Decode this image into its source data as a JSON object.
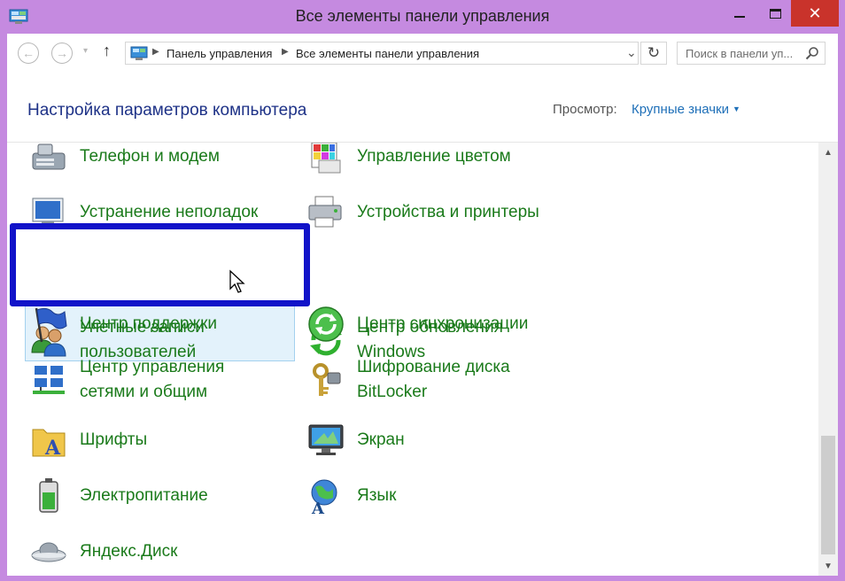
{
  "window": {
    "title": "Все элементы панели управления",
    "close_glyph": "✕"
  },
  "navbar": {
    "back_glyph": "←",
    "forward_glyph": "→",
    "history_glyph": "▾",
    "up_glyph": "↑",
    "breadcrumbs": [
      "Панель управления",
      "Все элементы панели управления"
    ],
    "crumb_separator": "▶",
    "dropdown_glyph": "⌄",
    "refresh_glyph": "↻",
    "search_placeholder": "Поиск в панели уп..."
  },
  "header": {
    "title": "Настройка параметров компьютера",
    "view_label": "Просмотр:",
    "view_value": "Крупные значки",
    "view_caret": "▼"
  },
  "items": [
    {
      "label": "Телефон и модем",
      "icon": "phone-modem-icon"
    },
    {
      "label": "Управление цветом",
      "icon": "color-management-icon"
    },
    {
      "label": "Устранение неполадок",
      "icon": "troubleshooting-icon"
    },
    {
      "label": "Устройства и принтеры",
      "icon": "devices-printers-icon"
    },
    {
      "label": "Учетные записи\nпользователей",
      "icon": "user-accounts-icon",
      "highlighted": true
    },
    {
      "label": "Центр обновления\nWindows",
      "icon": "windows-update-icon"
    },
    {
      "label": "Центр поддержки",
      "icon": "action-center-flag-icon"
    },
    {
      "label": "Центр синхронизации",
      "icon": "sync-center-icon"
    },
    {
      "label": "Центр управления\nсетями и общим",
      "icon": "network-center-icon"
    },
    {
      "label": "Шифрование диска\nBitLocker",
      "icon": "bitlocker-keys-icon"
    },
    {
      "label": "Шрифты",
      "icon": "fonts-folder-icon"
    },
    {
      "label": "Экран",
      "icon": "display-monitor-icon"
    },
    {
      "label": "Электропитание",
      "icon": "power-battery-icon"
    },
    {
      "label": "Язык",
      "icon": "language-globe-icon"
    },
    {
      "label": "Яндекс.Диск",
      "icon": "yandex-disk-icon"
    }
  ],
  "scrollbar": {
    "up_glyph": "▲",
    "down_glyph": "▼"
  },
  "colors": {
    "frame": "#c58ae0",
    "link_green": "#1a7a1a",
    "title_blue": "#1e3287",
    "highlight_frame": "#1113c9",
    "close_red": "#c9332b"
  }
}
